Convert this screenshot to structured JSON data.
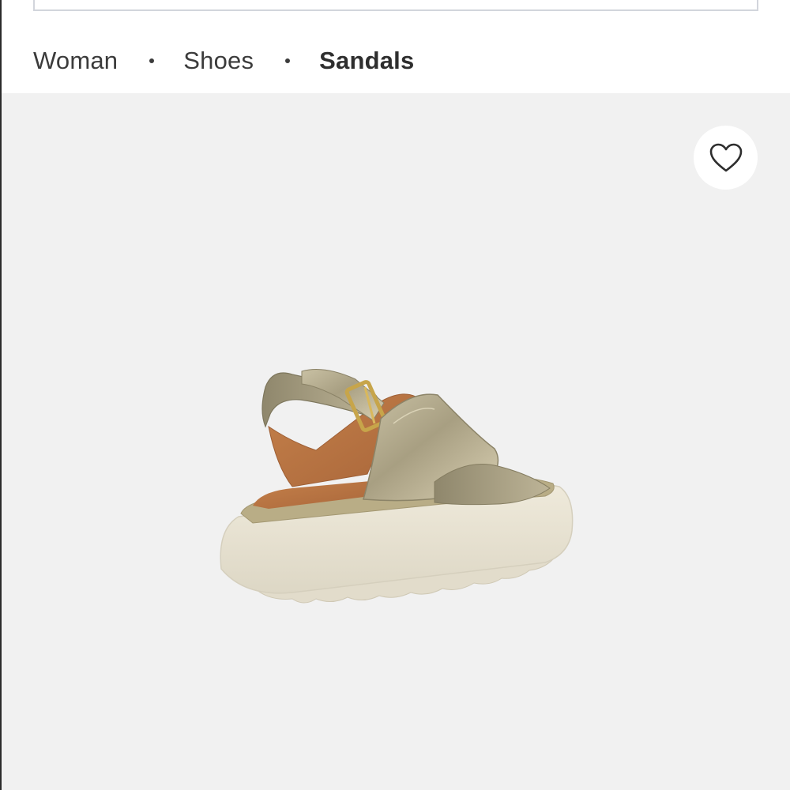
{
  "breadcrumb": {
    "items": [
      {
        "label": "Woman"
      },
      {
        "label": "Shoes"
      },
      {
        "label": "Sandals"
      }
    ]
  },
  "wishlist": {
    "icon": "heart-outline-icon"
  },
  "product": {
    "image_subject": "metallic gold platform sandal"
  },
  "colors": {
    "product_background": "#f1f1f1",
    "text": "#3b3b3b",
    "search_border": "#d2d5dc"
  }
}
